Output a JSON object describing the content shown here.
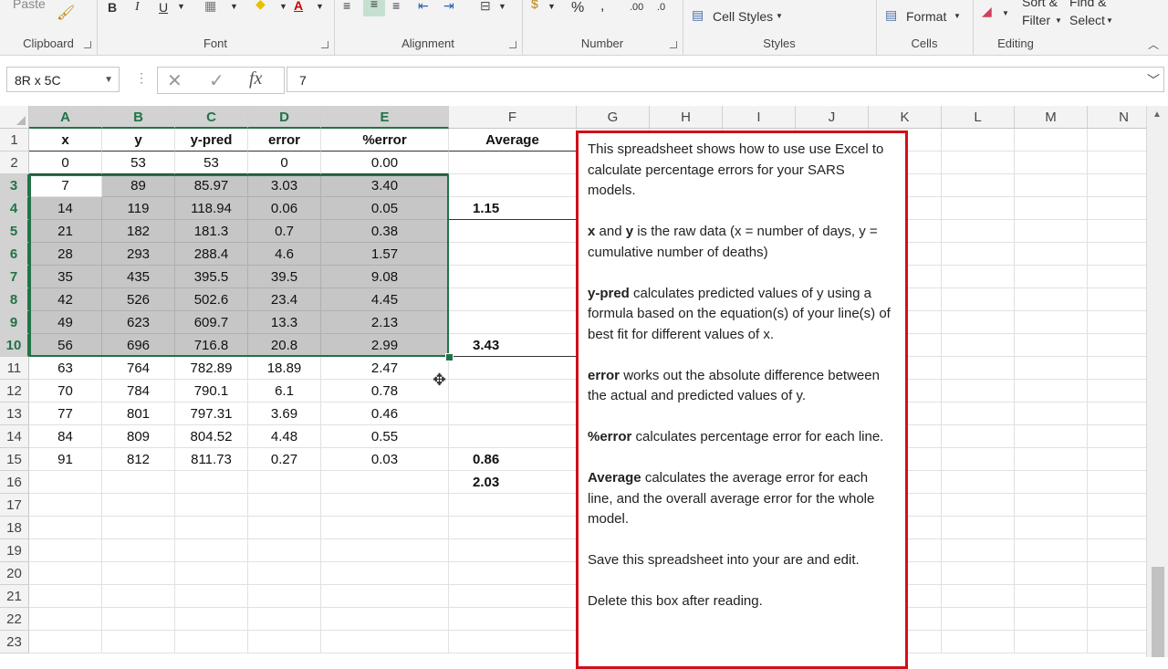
{
  "ribbon": {
    "groups": [
      {
        "label": "Clipboard"
      },
      {
        "label": "Font"
      },
      {
        "label": "Alignment"
      },
      {
        "label": "Number"
      },
      {
        "label": "Styles"
      },
      {
        "label": "Cells"
      },
      {
        "label": "Editing"
      }
    ],
    "paste_label": "Paste",
    "bold": "B",
    "italic": "I",
    "underline": "U",
    "percent": "%",
    "comma": ",",
    "cell_styles_label": "Cell Styles",
    "format_label": "Format",
    "sort_filter_label_1": "Sort &",
    "sort_filter_label_2": "Filter",
    "find_select_label_1": "Find &",
    "find_select_label_2": "Select",
    "inc_decimal": ".00",
    "dec_decimal": ".0"
  },
  "formula_bar": {
    "name_box": "8R x 5C",
    "cancel": "✕",
    "enter": "✓",
    "fx": "fx",
    "value": "7"
  },
  "columns": [
    "A",
    "B",
    "C",
    "D",
    "E",
    "F",
    "G",
    "H",
    "I",
    "J",
    "K",
    "L",
    "M",
    "N"
  ],
  "rows": [
    "1",
    "2",
    "3",
    "4",
    "5",
    "6",
    "7",
    "8",
    "9",
    "10",
    "11",
    "12",
    "13",
    "14",
    "15",
    "16",
    "17",
    "18",
    "19",
    "20",
    "21",
    "22",
    "23"
  ],
  "table": {
    "headers": [
      "x",
      "y",
      "y-pred",
      "error",
      "%error"
    ],
    "average_header": "Average",
    "data": [
      [
        "0",
        "53",
        "53",
        "0",
        "0.00"
      ],
      [
        "7",
        "89",
        "85.97",
        "3.03",
        "3.40"
      ],
      [
        "14",
        "119",
        "118.94",
        "0.06",
        "0.05"
      ],
      [
        "21",
        "182",
        "181.3",
        "0.7",
        "0.38"
      ],
      [
        "28",
        "293",
        "288.4",
        "4.6",
        "1.57"
      ],
      [
        "35",
        "435",
        "395.5",
        "39.5",
        "9.08"
      ],
      [
        "42",
        "526",
        "502.6",
        "23.4",
        "4.45"
      ],
      [
        "49",
        "623",
        "609.7",
        "13.3",
        "2.13"
      ],
      [
        "56",
        "696",
        "716.8",
        "20.8",
        "2.99"
      ],
      [
        "63",
        "764",
        "782.89",
        "18.89",
        "2.47"
      ],
      [
        "70",
        "784",
        "790.1",
        "6.1",
        "0.78"
      ],
      [
        "77",
        "801",
        "797.31",
        "3.69",
        "0.46"
      ],
      [
        "84",
        "809",
        "804.52",
        "4.48",
        "0.55"
      ],
      [
        "91",
        "812",
        "811.73",
        "0.27",
        "0.03"
      ]
    ],
    "averages": {
      "row4": "1.15",
      "row10": "3.43",
      "row15": "0.86",
      "row16": "2.03"
    }
  },
  "note": {
    "p1": "This spreadsheet shows how to use  use Excel to calculate percentage errors for your SARS models.",
    "p2_bold1": "x",
    "p2_mid": " and ",
    "p2_bold2": "y",
    "p2_rest": " is the raw data (x = number of days, y = cumulative number of deaths)",
    "p3_bold": "y-pred",
    "p3_rest": "  calculates predicted values of y using a formula based on the equation(s) of your line(s) of best fit for different values of x.",
    "p4_bold": "error",
    "p4_rest": "  works  out the absolute difference between the actual and predicted values of y.",
    "p5_bold": "%error",
    "p5_rest": " calculates  percentage error for each line.",
    "p6_bold": "Average",
    "p6_rest": "  calculates the average error for each line, and the overall average error  for the whole model.",
    "p7": "Save this spreadsheet into your are and edit.",
    "p8": "Delete this box after reading."
  },
  "colors": {
    "accent": "#217346",
    "note_border": "#d0101a",
    "selection": "#c6c6c6"
  }
}
